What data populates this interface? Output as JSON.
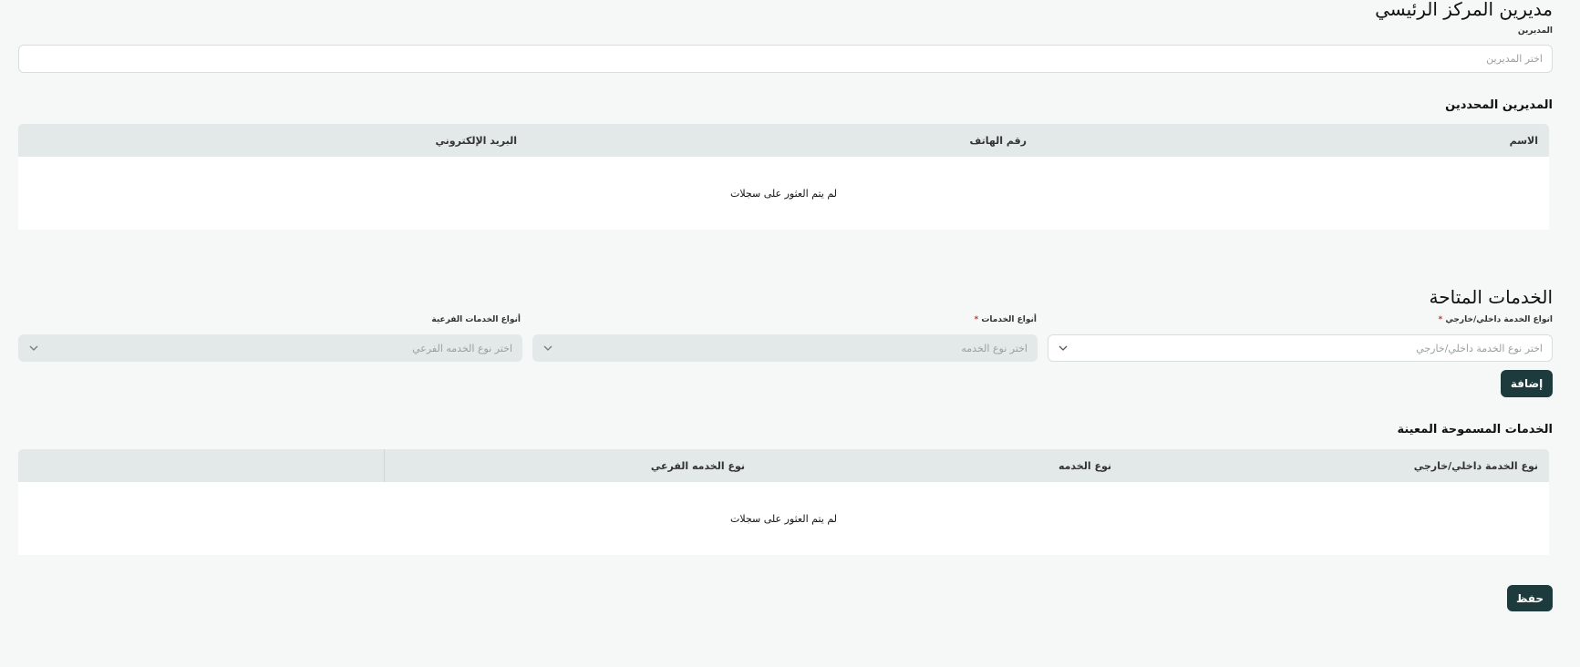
{
  "managers": {
    "title": "مديرين المركز الرئيسي",
    "field_label": "المديرين",
    "placeholder": "اختر المديرين",
    "selected_title": "المديرين المحددين",
    "columns": [
      "الاسم",
      "رقم الهاتف",
      "البريد الإلكتروني"
    ],
    "empty_text": "لم يتم العثور على سجلات"
  },
  "services": {
    "title": "الخدمات المتاحة",
    "fields": [
      {
        "label": "انواع الخدمة داخلي/خارجي",
        "required": "*",
        "placeholder": "اختر نوع الخدمة داخلي/خارجي"
      },
      {
        "label": "أنواع الخدمات",
        "required": "*",
        "placeholder": "اختر نوع الخدمه"
      },
      {
        "label": "أنواع الخدمات الفرعية",
        "required": "",
        "placeholder": "اختر نوع الخدمه الفرعي"
      }
    ],
    "add_label": "إضافة",
    "allowed_title": "الخدمات المسموحة المعينة",
    "columns": [
      "نوع الخدمة داخلي/خارجي",
      "نوع الخدمه",
      "نوع الخدمه الفرعي"
    ],
    "empty_text": "لم يتم العثور على سجلات"
  },
  "save_label": "حفظ",
  "colors": {
    "primary": "#1d3a3d",
    "header_bg": "#e3e8e8",
    "page_bg": "#f6f8f8",
    "required": "#d32f2f"
  }
}
